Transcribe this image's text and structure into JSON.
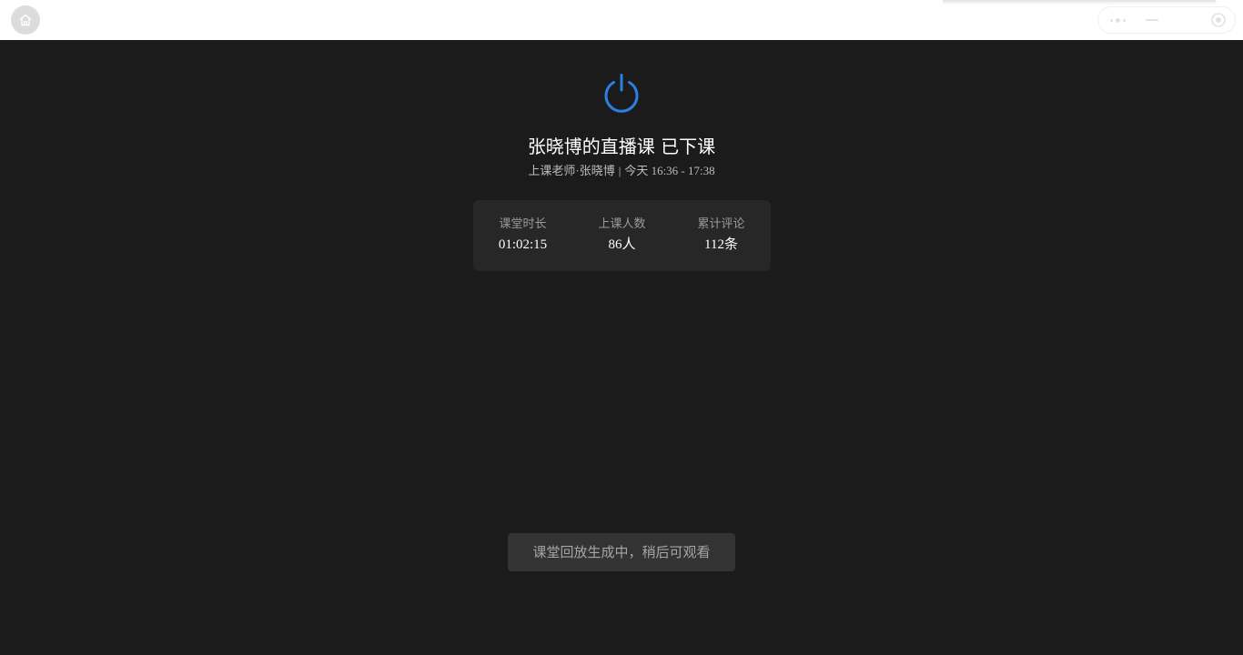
{
  "topbar": {
    "home_icon": "home-icon",
    "controls": {
      "more_icon": "more-dots-icon",
      "minimize_icon": "minimize-icon",
      "close_icon": "close-circle-icon"
    }
  },
  "main": {
    "status_icon": "power-icon",
    "accent_color": "#2b7fe0",
    "title": "张晓博的直播课 已下课",
    "subtitle": {
      "teacher": "上课老师·张晓博",
      "separator": "|",
      "time": "今天 16:36 - 17:38"
    },
    "stats": [
      {
        "label": "课堂时长",
        "value": "01:02:15"
      },
      {
        "label": "上课人数",
        "value": "86人"
      },
      {
        "label": "累计评论",
        "value": "112条"
      }
    ],
    "replay_notice": "课堂回放生成中，稍后可观看"
  }
}
